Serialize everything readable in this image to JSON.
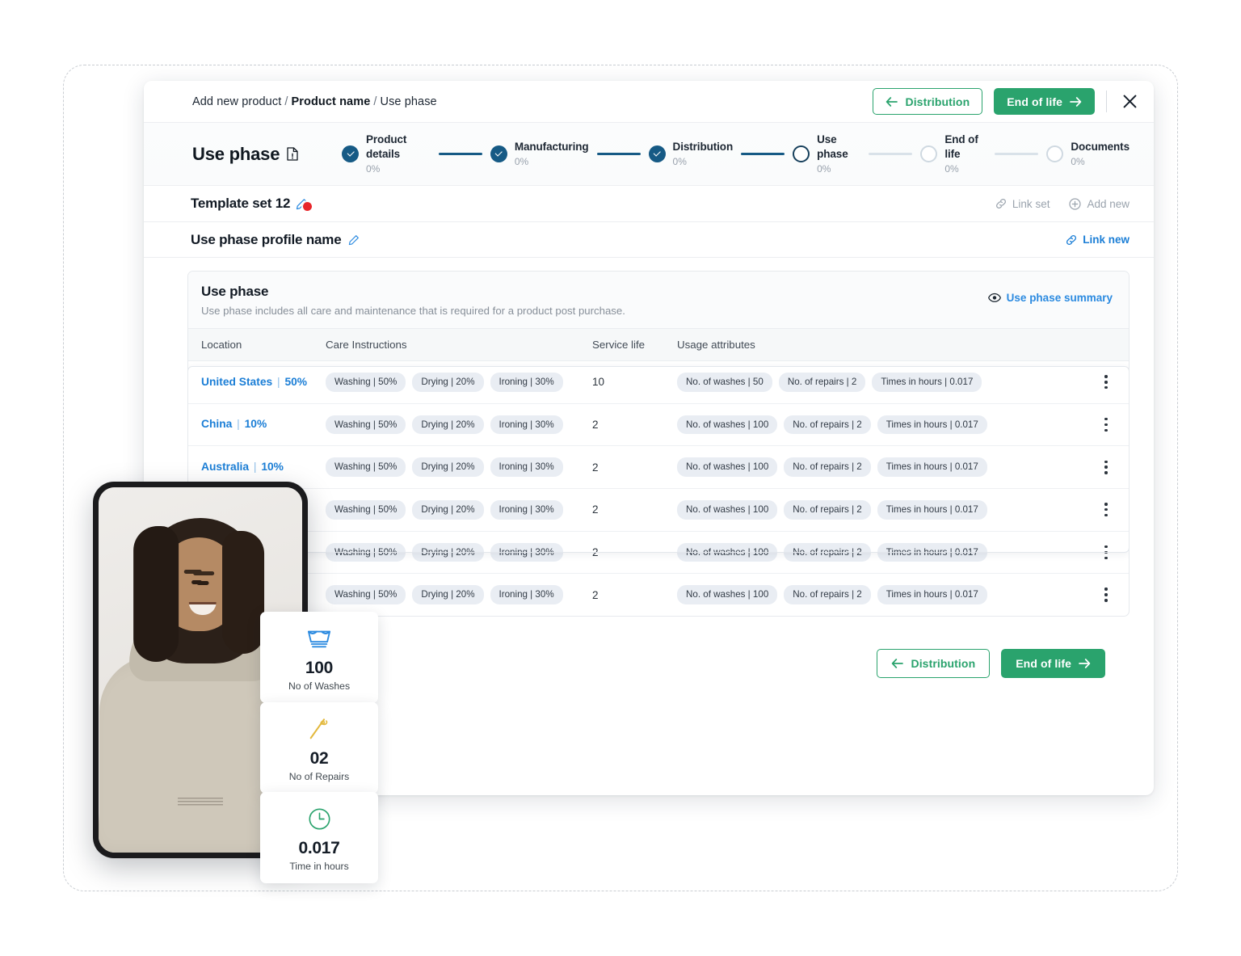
{
  "breadcrumb": {
    "root": "Add new product",
    "sep": "/",
    "product": "Product name",
    "current": "Use phase"
  },
  "topbar": {
    "back_label": "Distribution",
    "next_label": "End of life",
    "close_icon": "close-icon",
    "back_icon": "arrow-left-icon",
    "next_icon": "arrow-right-icon"
  },
  "page": {
    "title": "Use phase",
    "title_icon": "document-icon"
  },
  "stepper": {
    "steps": [
      {
        "label": "Product details",
        "percent": "0%",
        "state": "done"
      },
      {
        "label": "Manufacturing",
        "percent": "0%",
        "state": "done"
      },
      {
        "label": "Distribution",
        "percent": "0%",
        "state": "done"
      },
      {
        "label": "Use phase",
        "percent": "0%",
        "state": "current"
      },
      {
        "label": "End of life",
        "percent": "0%",
        "state": "future"
      },
      {
        "label": "Documents",
        "percent": "0%",
        "state": "future"
      }
    ]
  },
  "template_row": {
    "title": "Template set 12",
    "edit_icon": "pencil-icon",
    "link_set_label": "Link set",
    "link_set_icon": "link-icon",
    "add_new_label": "Add new",
    "add_new_icon": "plus-circle-icon"
  },
  "profile_row": {
    "title": "Use phase profile name",
    "edit_icon": "pencil-icon",
    "link_new_label": "Link new",
    "link_new_icon": "link-icon"
  },
  "card": {
    "heading": "Use phase",
    "description": "Use phase includes all care and maintenance that is required for a product post purchase.",
    "summary_label": "Use phase summary",
    "summary_icon": "eye-icon"
  },
  "table": {
    "columns": [
      "Location",
      "Care Instructions",
      "Service life",
      "Usage attributes"
    ],
    "rows": [
      {
        "location": "United States",
        "location_share": "50%",
        "care": [
          "Washing | 50%",
          "Drying | 20%",
          "Ironing | 30%"
        ],
        "service_life": "10",
        "usage": [
          "No. of washes | 50",
          "No. of repairs | 2",
          "Times in hours | 0.017"
        ]
      },
      {
        "location": "China",
        "location_share": "10%",
        "care": [
          "Washing | 50%",
          "Drying | 20%",
          "Ironing | 30%"
        ],
        "service_life": "2",
        "usage": [
          "No. of washes | 100",
          "No. of repairs | 2",
          "Times in hours | 0.017"
        ]
      },
      {
        "location": "Australia",
        "location_share": "10%",
        "care": [
          "Washing | 50%",
          "Drying | 20%",
          "Ironing | 30%"
        ],
        "service_life": "2",
        "usage": [
          "No. of washes | 100",
          "No. of repairs | 2",
          "Times in hours | 0.017"
        ]
      },
      {
        "location": "",
        "location_share": "",
        "care": [
          "Washing | 50%",
          "Drying | 20%",
          "Ironing | 30%"
        ],
        "service_life": "2",
        "usage": [
          "No. of washes | 100",
          "No. of repairs | 2",
          "Times in hours | 0.017"
        ]
      },
      {
        "location": "",
        "location_share": "",
        "care": [
          "Washing | 50%",
          "Drying | 20%",
          "Ironing | 30%"
        ],
        "service_life": "2",
        "usage": [
          "No. of washes | 100",
          "No. of repairs | 2",
          "Times in hours | 0.017"
        ]
      },
      {
        "location": "",
        "location_share": "",
        "care": [
          "Washing | 50%",
          "Drying | 20%",
          "Ironing | 30%"
        ],
        "service_life": "2",
        "usage": [
          "No. of washes | 100",
          "No. of repairs | 2",
          "Times in hours | 0.017"
        ]
      }
    ],
    "row_menu_icon": "kebab-menu-icon"
  },
  "footer": {
    "back_label": "Distribution",
    "next_label": "End of life"
  },
  "stat_cards": [
    {
      "id": "washes",
      "icon": "washing-basin-icon",
      "value": "100",
      "label": "No of Washes"
    },
    {
      "id": "repairs",
      "icon": "needle-thread-icon",
      "value": "02",
      "label": "No of Repairs"
    },
    {
      "id": "hours",
      "icon": "clock-icon",
      "value": "0.017",
      "label": "Time in hours"
    }
  ],
  "colors": {
    "brand_green": "#2aa36d",
    "link_blue": "#1b7ed6",
    "step_navy": "#165a85",
    "chip_bg": "#e9edf3",
    "icon_wash_blue": "#2b8ae0",
    "icon_needle_gold": "#e3b93f",
    "icon_clock_green": "#2aa36d"
  },
  "device_preview": {
    "alt": "product-photo-person-wearing-beige-hoodie"
  }
}
